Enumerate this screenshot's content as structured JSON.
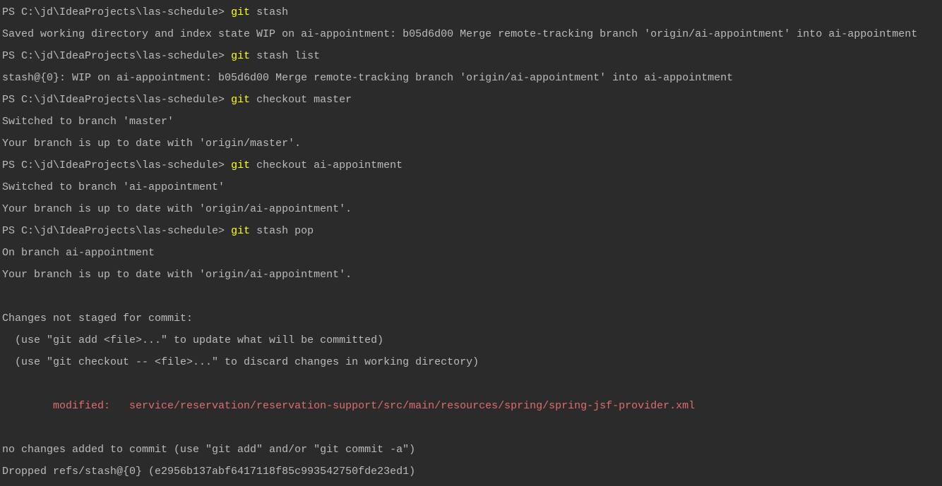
{
  "terminal": {
    "prompt": "PS C:\\jd\\IdeaProjects\\las-schedule> ",
    "colors": {
      "background": "#2b2b2b",
      "text": "#bbbbbb",
      "command_keyword": "#ffff00",
      "modified": "#e06c6c"
    },
    "lines": [
      {
        "kind": "cmd",
        "keyword": "git",
        "args": " stash"
      },
      {
        "kind": "out",
        "text": "Saved working directory and index state WIP on ai-appointment: b05d6d00 Merge remote-tracking branch 'origin/ai-appointment' into ai-appointment"
      },
      {
        "kind": "cmd",
        "keyword": "git",
        "args": " stash list"
      },
      {
        "kind": "out",
        "text": "stash@{0}: WIP on ai-appointment: b05d6d00 Merge remote-tracking branch 'origin/ai-appointment' into ai-appointment"
      },
      {
        "kind": "cmd",
        "keyword": "git",
        "args": " checkout master"
      },
      {
        "kind": "out",
        "text": "Switched to branch 'master'"
      },
      {
        "kind": "out",
        "text": "Your branch is up to date with 'origin/master'."
      },
      {
        "kind": "cmd",
        "keyword": "git",
        "args": " checkout ai-appointment"
      },
      {
        "kind": "out",
        "text": "Switched to branch 'ai-appointment'"
      },
      {
        "kind": "out",
        "text": "Your branch is up to date with 'origin/ai-appointment'."
      },
      {
        "kind": "cmd",
        "keyword": "git",
        "args": " stash pop"
      },
      {
        "kind": "out",
        "text": "On branch ai-appointment"
      },
      {
        "kind": "out",
        "text": "Your branch is up to date with 'origin/ai-appointment'."
      },
      {
        "kind": "blank",
        "text": ""
      },
      {
        "kind": "out",
        "text": "Changes not staged for commit:"
      },
      {
        "kind": "out",
        "text": "  (use \"git add <file>...\" to update what will be committed)"
      },
      {
        "kind": "out",
        "text": "  (use \"git checkout -- <file>...\" to discard changes in working directory)"
      },
      {
        "kind": "blank",
        "text": ""
      },
      {
        "kind": "mod",
        "text": "        modified:   service/reservation/reservation-support/src/main/resources/spring/spring-jsf-provider.xml"
      },
      {
        "kind": "blank",
        "text": ""
      },
      {
        "kind": "out",
        "text": "no changes added to commit (use \"git add\" and/or \"git commit -a\")"
      },
      {
        "kind": "out",
        "text": "Dropped refs/stash@{0} (e2956b137abf6417118f85c993542750fde23ed1)"
      }
    ]
  }
}
